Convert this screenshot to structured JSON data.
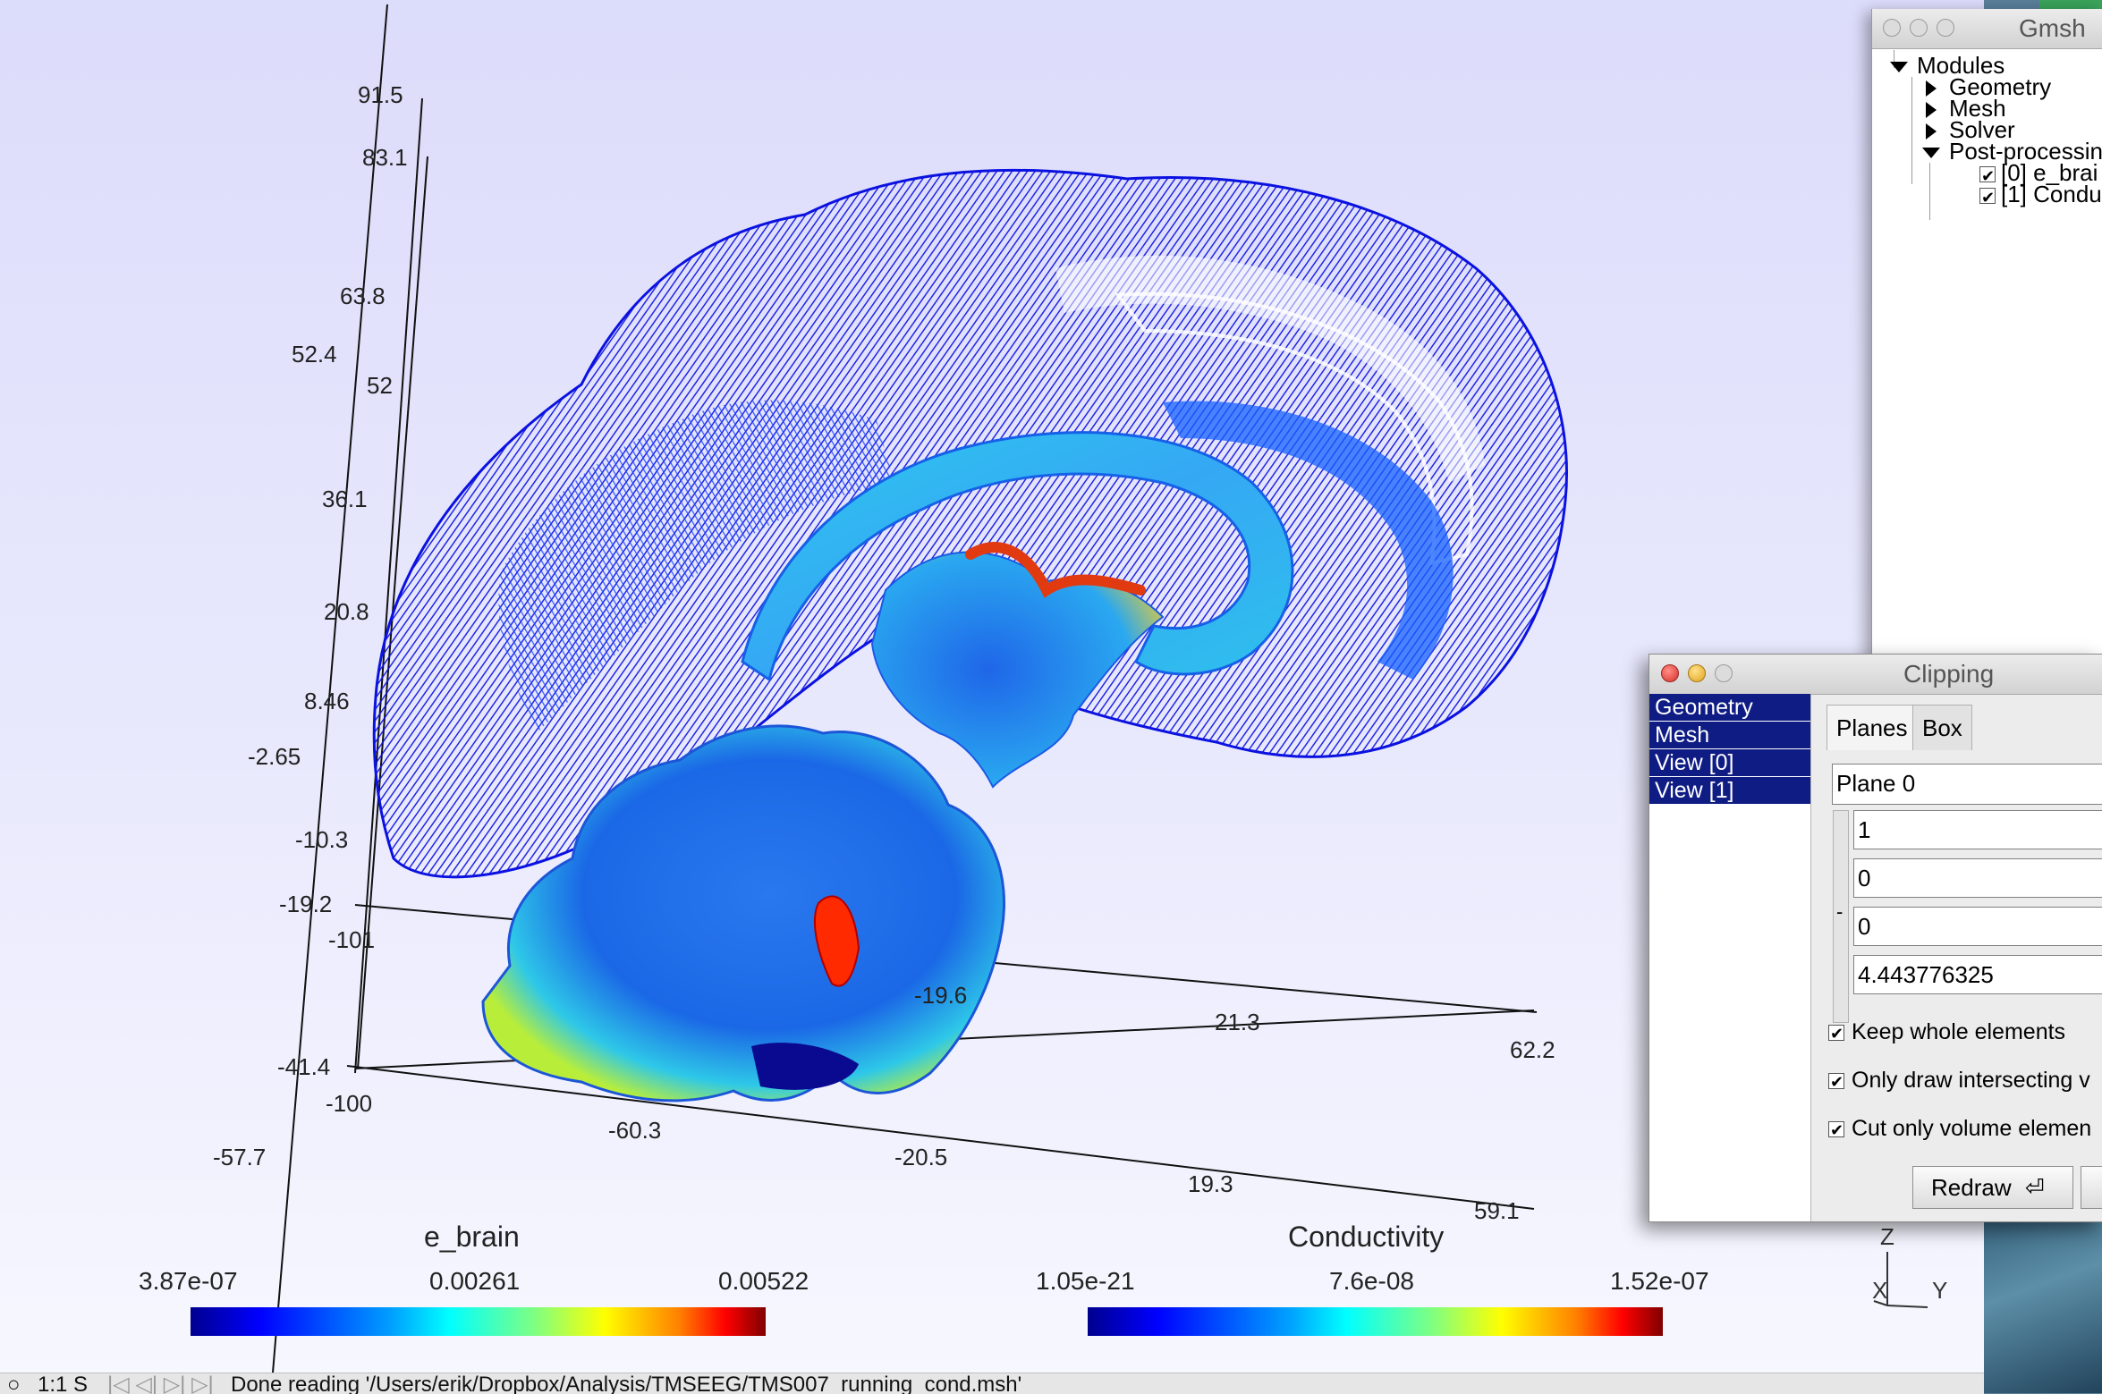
{
  "axes": {
    "vertical_ticks": [
      "91.5",
      "83.1",
      "63.8",
      "52.4",
      "52",
      "36.1",
      "20.8",
      "8.46",
      "-2.65",
      "-10.3",
      "-19.2",
      "-41.4",
      "-57.7"
    ],
    "front_axis_ticks": [
      "-101",
      "-19.6",
      "21.3",
      "62.2"
    ],
    "bottom_axis_ticks": [
      "-100",
      "-60.3",
      "-20.5",
      "19.3",
      "59.1"
    ]
  },
  "colorbars": [
    {
      "title": "e_brain",
      "labels": [
        "3.87e-07",
        "0.00261",
        "0.00522"
      ]
    },
    {
      "title": "Conductivity",
      "labels": [
        "1.05e-21",
        "7.6e-08",
        "1.52e-07"
      ]
    }
  ],
  "orientation": {
    "z": "Z",
    "x": "X",
    "y": "Y"
  },
  "statusbar": {
    "zoom": "1:1 S",
    "nav": "|◁ ◁| ▷| ▷|",
    "message": "Done reading '/Users/erik/Dropbox/Analysis/TMSEEG/TMS007_running_cond.msh'"
  },
  "gmsh_window": {
    "title": "Gmsh",
    "tree": {
      "modules": "Modules",
      "geometry": "Geometry",
      "mesh": "Mesh",
      "solver": "Solver",
      "post": "Post-processin",
      "view0": "[0] e_brai",
      "view1": "[1] Condu"
    }
  },
  "clipping_window": {
    "title": "Clipping",
    "list": [
      "Geometry",
      "Mesh",
      "View [0]",
      "View [1]"
    ],
    "tabs": [
      "Planes",
      "Box"
    ],
    "plane_select": "Plane 0",
    "stepper_label": "-",
    "coefficients": [
      "1",
      "0",
      "0",
      "4.443776325"
    ],
    "checks": [
      "Keep whole elements",
      "Only draw intersecting v",
      "Cut only volume elemen"
    ],
    "redraw_label": "Redraw",
    "redraw_icon": "return-arrow-icon"
  },
  "colors": {
    "list_highlight": "#0f1c84",
    "background_top": "#dcdcfb",
    "colormap": [
      "#00008f",
      "#0000ff",
      "#00a0ff",
      "#00ffff",
      "#80ff80",
      "#ffff00",
      "#ff8000",
      "#ff0000",
      "#800000"
    ]
  }
}
